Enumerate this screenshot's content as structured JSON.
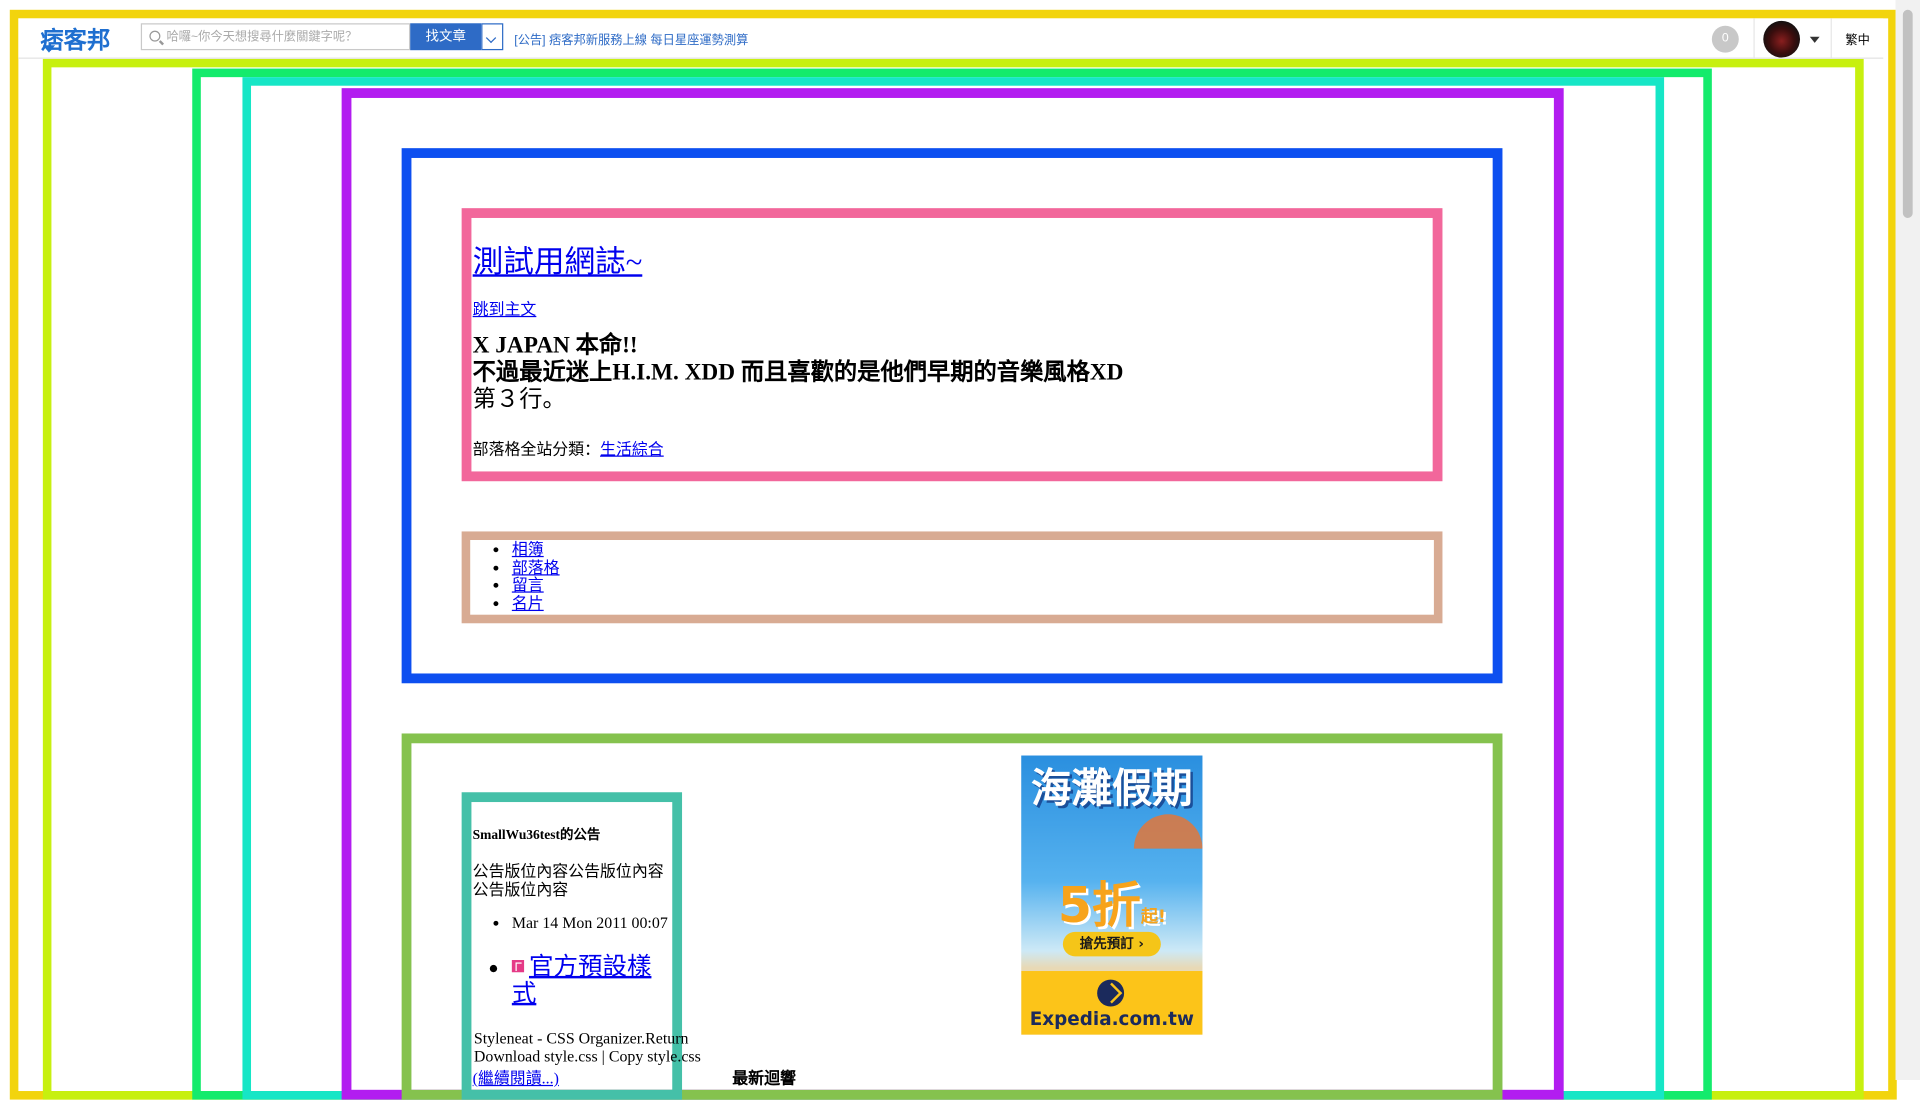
{
  "topbar": {
    "logo": "痞客邦",
    "search_placeholder": "哈囉~你今天想搜尋什麼關鍵字呢？",
    "find_button": "找文章",
    "announcement": "[公告] 痞客邦新服務上線 每日星座運勢測算",
    "notification_count": "0",
    "language": "繁中"
  },
  "blog": {
    "title": "測試用網誌~",
    "skip_link": "跳到主文",
    "description": [
      "X JAPAN 本命!!",
      "不過最近迷上H.I.M. XDD 而且喜歡的是他們早期的音樂風格XD",
      "第３行。"
    ],
    "category_label": "部落格全站分類：",
    "category_value": "生活綜合"
  },
  "menu": [
    "相簿",
    "部落格",
    "留言",
    "名片"
  ],
  "sidebar": {
    "notice_title": "SmallWu36test的公告",
    "notice_text": "公告版位內容公告版位內容公告版位內容",
    "date": "Mar 14 Mon 2011 00:07",
    "post_title": "官方預設樣式",
    "article_text": "Styleneat - CSS Organizer.Return Download style.css | Copy style.css",
    "read_more": "(繼續閱讀...)",
    "latest_heading": "最新迴響"
  },
  "ad": {
    "headline": "海灘假期",
    "discount": "5折",
    "discount_suffix": "起!",
    "cta": "搶先預訂",
    "brand": "Expedia.com.tw"
  },
  "colors": {
    "frame_yellow": "#f2d40d",
    "frame_lime": "#c7f00f",
    "frame_green": "#14eb6c",
    "frame_teal": "#16e6c6",
    "frame_purple": "#b21df0",
    "frame_blue": "#0d4ff0",
    "frame_pink": "#f2679b",
    "frame_tan": "#d8ab93",
    "frame_olive": "#85c24e",
    "frame_sea": "#45c0a8"
  }
}
